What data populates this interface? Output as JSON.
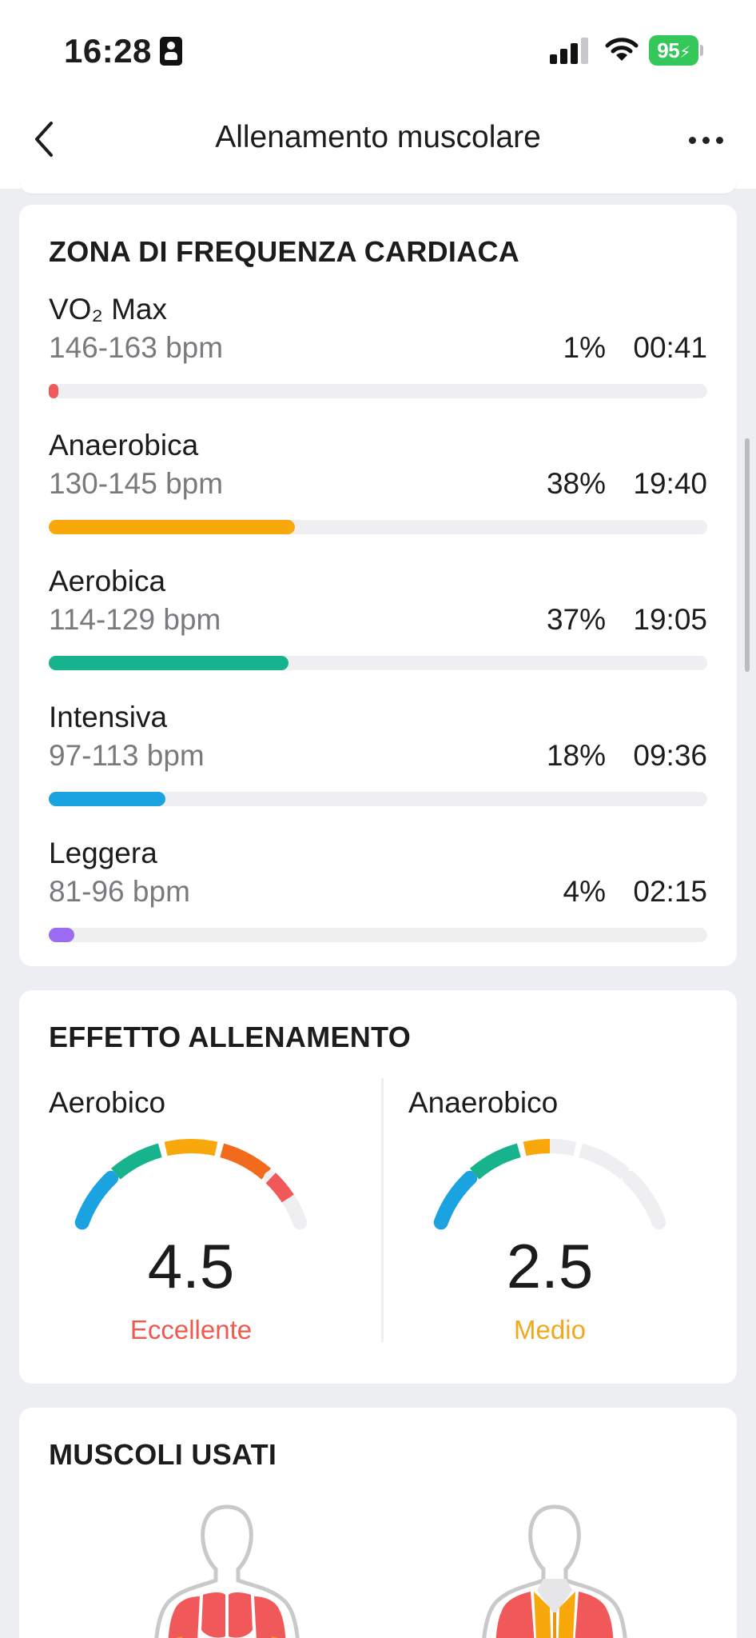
{
  "status_bar": {
    "time": "16:28",
    "battery": "95"
  },
  "header": {
    "title": "Allenamento muscolare"
  },
  "heart_rate_zones": {
    "title": "ZONA DI FREQUENZA CARDIACA",
    "zones": [
      {
        "name": "VO₂ Max",
        "range": "146-163 bpm",
        "percent": "1%",
        "duration": "00:41",
        "fraction": 0.01,
        "color": "#f0585a"
      },
      {
        "name": "Anaerobica",
        "range": "130-145 bpm",
        "percent": "38%",
        "duration": "19:40",
        "fraction": 0.38,
        "color": "#f9a80c"
      },
      {
        "name": "Aerobica",
        "range": "114-129 bpm",
        "percent": "37%",
        "duration": "19:05",
        "fraction": 0.37,
        "color": "#17b38c"
      },
      {
        "name": "Intensiva",
        "range": "97-113 bpm",
        "percent": "18%",
        "duration": "09:36",
        "fraction": 0.18,
        "color": "#1aa3e0"
      },
      {
        "name": "Leggera",
        "range": "81-96 bpm",
        "percent": "4%",
        "duration": "02:15",
        "fraction": 0.04,
        "color": "#9b6bf2"
      }
    ]
  },
  "training_effect": {
    "title": "EFFETTO ALLENAMENTO",
    "aerobic": {
      "label": "Aerobico",
      "value": "4.5",
      "level": "Eccellente",
      "level_color": "#ef5a50",
      "score": 4.5
    },
    "anaerobic": {
      "label": "Anaerobico",
      "value": "2.5",
      "level": "Medio",
      "level_color": "#f2a81d",
      "score": 2.5
    },
    "scale_colors": [
      "#1aa3e0",
      "#17b38c",
      "#f9a80c",
      "#f26a1b",
      "#f0585a"
    ],
    "track_color": "#efeff1"
  },
  "muscles": {
    "title": "MUSCOLI USATI"
  }
}
